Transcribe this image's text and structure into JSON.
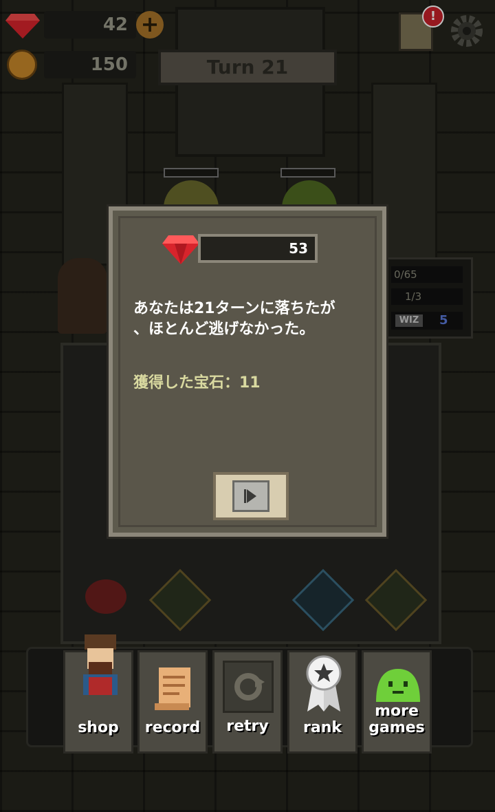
{
  "hud": {
    "gems": "42",
    "coins": "150",
    "turn": "Turn 21",
    "side_stats": [
      "0/65",
      "1/3"
    ],
    "class_tag": "WIZ",
    "class_level": "5"
  },
  "modal": {
    "gem_total": "53",
    "message_line1": "あなたは21ターンに落ちたが",
    "message_line2": "、ほとんど逃げなかった。",
    "earned": "獲得した宝石：11"
  },
  "menu": {
    "shop": "shop",
    "record": "record",
    "retry": "retry",
    "rank": "rank",
    "more_games_1": "more",
    "more_games_2": "games"
  },
  "colors": {
    "gem": "#d8242c",
    "coin": "#c9882a",
    "slime": "#6fcf3a",
    "alert": "#c8202a"
  }
}
